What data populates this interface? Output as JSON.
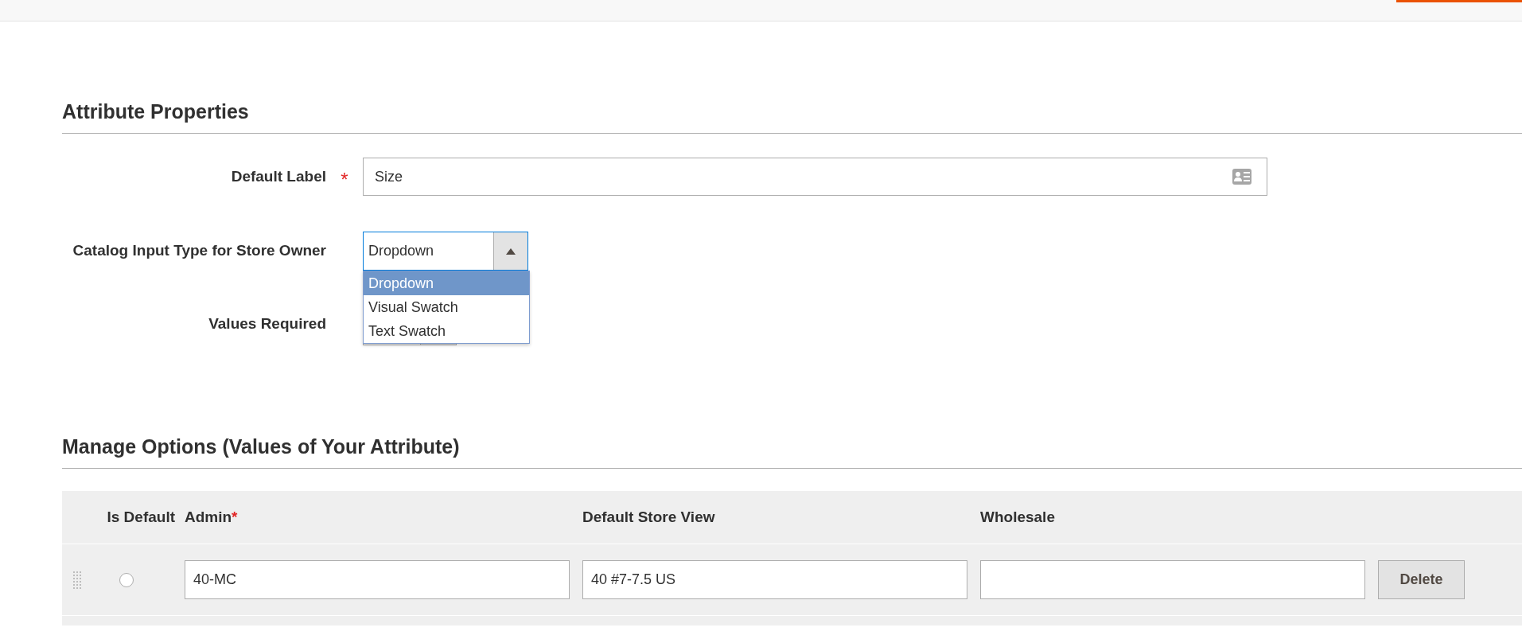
{
  "attribute_properties": {
    "title": "Attribute Properties",
    "fields": [
      {
        "kind": "text",
        "label": "Default Label",
        "required_mark": "*",
        "value": "Size"
      },
      {
        "kind": "select",
        "label": "Catalog Input Type for Store Owner",
        "value": "Dropdown",
        "expanded": true,
        "options": [
          {
            "label": "Dropdown",
            "selected": true
          },
          {
            "label": "Visual Swatch",
            "selected": false
          },
          {
            "label": "Text Swatch",
            "selected": false
          }
        ]
      },
      {
        "kind": "select",
        "label": "Values Required",
        "expanded": false
      }
    ]
  },
  "manage_options": {
    "title": "Manage Options (Values of Your Attribute)",
    "columns": [
      {
        "label": "Is Default"
      },
      {
        "label": "Admin",
        "required_mark": "*"
      },
      {
        "label": "Default Store View"
      },
      {
        "label": "Wholesale"
      }
    ],
    "rows": [
      {
        "is_default": false,
        "admin": "40-MC",
        "default_store_view": "40 #7-7.5 US",
        "delete": "Delete"
      }
    ]
  }
}
